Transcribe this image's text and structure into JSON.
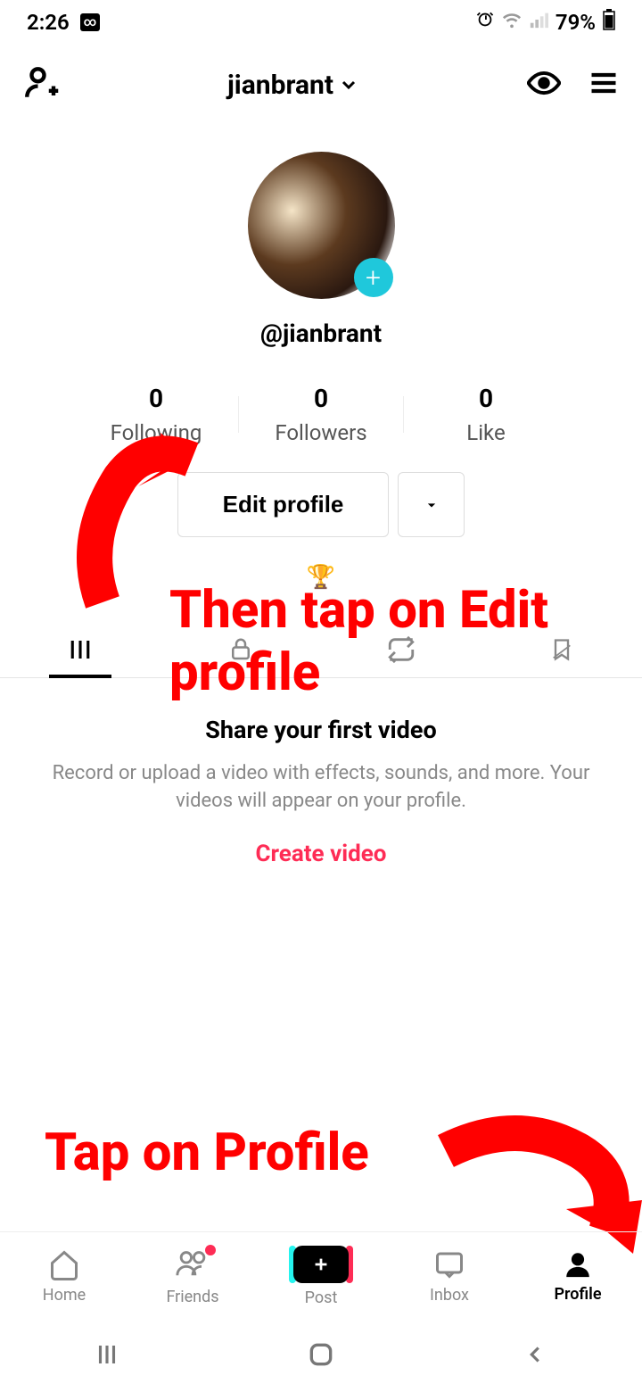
{
  "status_bar": {
    "time": "2:26",
    "battery": "79%"
  },
  "header": {
    "username": "jianbrant"
  },
  "profile": {
    "handle": "@jianbrant"
  },
  "stats": {
    "following": {
      "value": "0",
      "label": "Following"
    },
    "followers": {
      "value": "0",
      "label": "Followers"
    },
    "like": {
      "value": "0",
      "label": "Like"
    }
  },
  "actions": {
    "edit_profile": "Edit profile"
  },
  "trophy_emoji": "🏆",
  "empty_state": {
    "title": "Share your first video",
    "description": "Record or upload a video with effects, sounds, and more. Your videos will appear on your profile.",
    "action": "Create video"
  },
  "annotations": {
    "edit_profile_text": "Then tap on Edit profile",
    "profile_text": "Tap on Profile"
  },
  "nav": {
    "home": "Home",
    "friends": "Friends",
    "post": "Post",
    "inbox": "Inbox",
    "profile": "Profile"
  }
}
